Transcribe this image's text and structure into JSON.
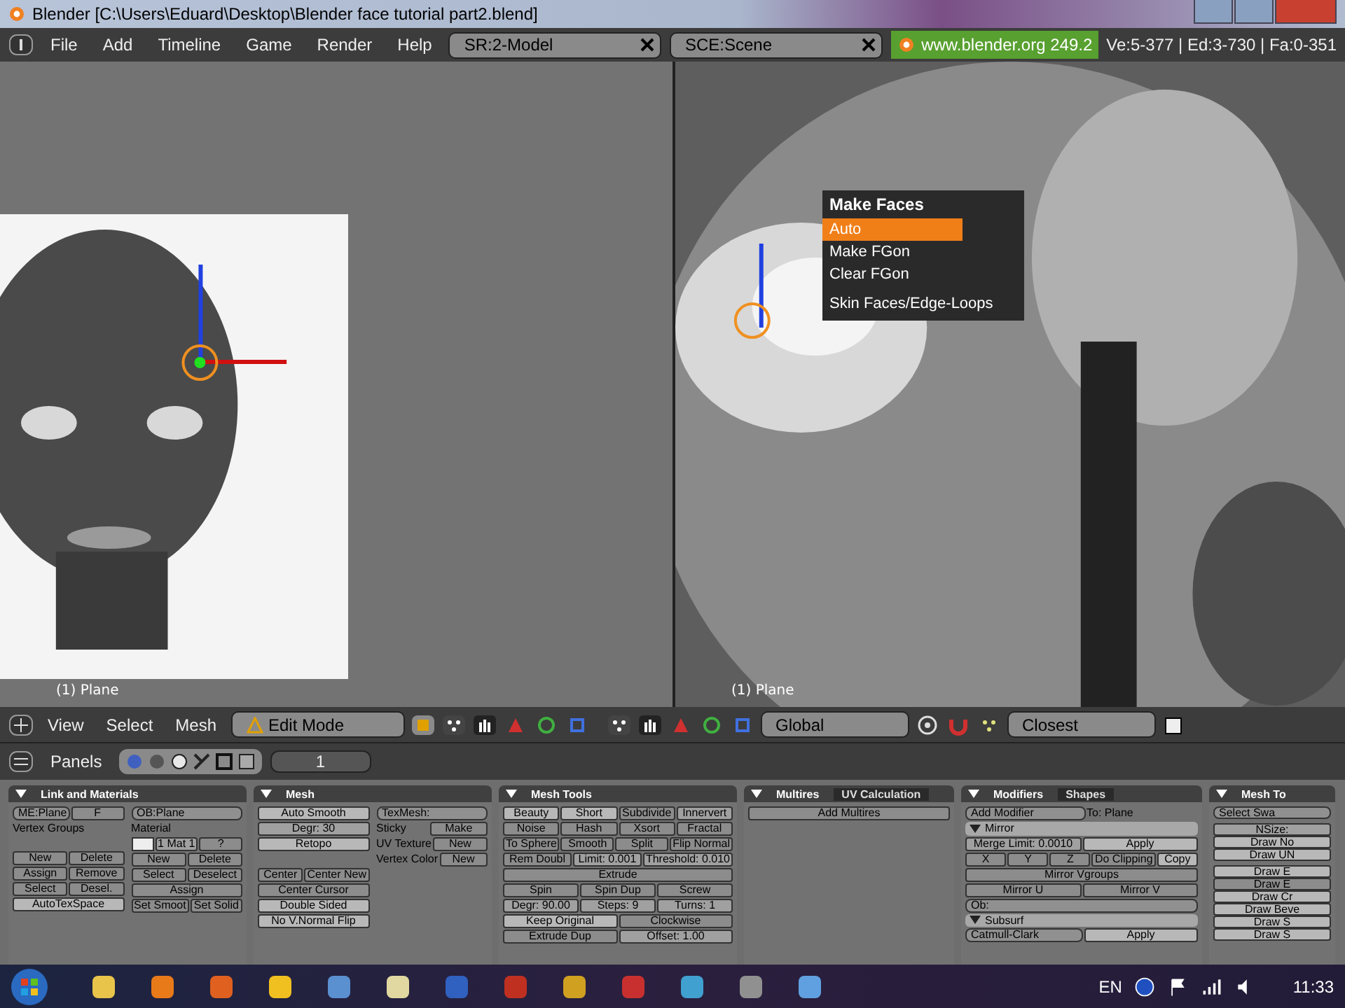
{
  "window": {
    "title": "Blender [C:\\Users\\Eduard\\Desktop\\Blender face tutorial part2.blend]"
  },
  "menu": [
    "File",
    "Add",
    "Timeline",
    "Game",
    "Render",
    "Help"
  ],
  "screen_field": "SR:2-Model",
  "scene_field": "SCE:Scene",
  "version": "www.blender.org 249.2",
  "stats": "Ve:5-377 | Ed:3-730 | Fa:0-351",
  "viewports": [
    {
      "label": "(1) Plane"
    },
    {
      "label": "(1) Plane"
    }
  ],
  "popup": {
    "title": "Make Faces",
    "items": [
      {
        "label": "Auto",
        "selected": true
      },
      {
        "label": "Make FGon",
        "selected": false
      },
      {
        "label": "Clear FGon",
        "selected": false
      },
      {
        "label": "Skin Faces/Edge-Loops",
        "selected": false
      }
    ]
  },
  "view_header": {
    "menu": [
      "View",
      "Select",
      "Mesh"
    ],
    "mode": "Edit Mode",
    "orientation": "Global",
    "snap": "Closest"
  },
  "buttons_header": {
    "label": "Panels",
    "frame": "1"
  },
  "panels": [
    {
      "tabs": [
        {
          "label": "Link and Materials",
          "selected": true
        }
      ],
      "columns": [
        [
          [
            {
              "kind": "field",
              "label": "ME:Plane"
            },
            {
              "kind": "button",
              "label": "F"
            }
          ],
          [
            {
              "kind": "label",
              "label": "Vertex Groups"
            }
          ],
          [
            {
              "kind": "space"
            }
          ],
          [
            {
              "kind": "button",
              "label": "New"
            },
            {
              "kind": "button",
              "label": "Delete"
            }
          ],
          [
            {
              "kind": "button",
              "label": "Assign"
            },
            {
              "kind": "button",
              "label": "Remove"
            }
          ],
          [
            {
              "kind": "button",
              "label": "Select"
            },
            {
              "kind": "button",
              "label": "Desel."
            }
          ],
          [
            {
              "kind": "light",
              "label": "AutoTexSpace"
            }
          ]
        ],
        [
          [
            {
              "kind": "field",
              "label": "OB:Plane"
            }
          ],
          [
            {
              "kind": "label",
              "label": "Material"
            }
          ],
          [
            {
              "kind": "swatch"
            },
            {
              "kind": "num",
              "label": "1 Mat 1"
            },
            {
              "kind": "button",
              "label": "?"
            }
          ],
          [
            {
              "kind": "button",
              "label": "New"
            },
            {
              "kind": "button",
              "label": "Delete"
            }
          ],
          [
            {
              "kind": "button",
              "label": "Select"
            },
            {
              "kind": "button",
              "label": "Deselect"
            }
          ],
          [
            {
              "kind": "button",
              "label": "Assign"
            }
          ],
          [
            {
              "kind": "button",
              "label": "Set Smoot"
            },
            {
              "kind": "button",
              "label": "Set Solid"
            }
          ]
        ]
      ]
    },
    {
      "tabs": [
        {
          "label": "Mesh",
          "selected": true
        }
      ],
      "columns": [
        [
          [
            {
              "kind": "light",
              "label": "Auto Smooth"
            }
          ],
          [
            {
              "kind": "num",
              "label": "Degr: 30"
            }
          ],
          [
            {
              "kind": "light",
              "label": "Retopo"
            }
          ],
          [
            {
              "kind": "space"
            }
          ],
          [
            {
              "kind": "button",
              "label": "Center"
            },
            {
              "kind": "button",
              "label": "Center New"
            }
          ],
          [
            {
              "kind": "button",
              "label": "Center Cursor"
            }
          ],
          [
            {
              "kind": "light",
              "label": "Double Sided"
            }
          ],
          [
            {
              "kind": "light",
              "label": "No V.Normal Flip"
            }
          ]
        ],
        [
          [
            {
              "kind": "field",
              "label": "TexMesh:"
            }
          ],
          [
            {
              "kind": "label",
              "label": "Sticky"
            },
            {
              "kind": "button",
              "label": "Make"
            }
          ],
          [
            {
              "kind": "label",
              "label": "UV Texture"
            },
            {
              "kind": "button",
              "label": "New"
            }
          ],
          [
            {
              "kind": "label",
              "label": "Vertex Color"
            },
            {
              "kind": "button",
              "label": "New"
            }
          ]
        ]
      ]
    },
    {
      "tabs": [
        {
          "label": "Mesh Tools",
          "selected": true
        }
      ],
      "columns": [
        [
          [
            {
              "kind": "light",
              "label": "Beauty"
            },
            {
              "kind": "light",
              "label": "Short"
            },
            {
              "kind": "button",
              "label": "Subdivide"
            },
            {
              "kind": "num",
              "label": "Innervert"
            }
          ],
          [
            {
              "kind": "button",
              "label": "Noise"
            },
            {
              "kind": "button",
              "label": "Hash"
            },
            {
              "kind": "button",
              "label": "Xsort"
            },
            {
              "kind": "button",
              "label": "Fractal"
            }
          ],
          [
            {
              "kind": "button",
              "label": "To Sphere"
            },
            {
              "kind": "button",
              "label": "Smooth"
            },
            {
              "kind": "button",
              "label": "Split"
            },
            {
              "kind": "button",
              "label": "Flip Normal"
            }
          ],
          [
            {
              "kind": "button",
              "label": "Rem Doubl"
            },
            {
              "kind": "num",
              "label": "Limit: 0.001"
            },
            {
              "kind": "num",
              "label": "Threshold: 0.010"
            }
          ],
          [
            {
              "kind": "button",
              "label": "Extrude"
            }
          ],
          [
            {
              "kind": "button",
              "label": "Spin"
            },
            {
              "kind": "button",
              "label": "Spin Dup"
            },
            {
              "kind": "button",
              "label": "Screw"
            }
          ],
          [
            {
              "kind": "num",
              "label": "Degr: 90.00"
            },
            {
              "kind": "num",
              "label": "Steps: 9"
            },
            {
              "kind": "num",
              "label": "Turns: 1"
            }
          ],
          [
            {
              "kind": "light",
              "label": "Keep Original"
            },
            {
              "kind": "button",
              "label": "Clockwise"
            }
          ],
          [
            {
              "kind": "button",
              "label": "Extrude Dup"
            },
            {
              "kind": "num",
              "label": "Offset: 1.00"
            }
          ]
        ]
      ]
    },
    {
      "tabs": [
        {
          "label": "Multires",
          "selected": true
        },
        {
          "label": "UV Calculation",
          "selected": false
        }
      ],
      "columns": [
        [
          [
            {
              "kind": "button",
              "label": "Add Multires"
            }
          ]
        ]
      ]
    },
    {
      "tabs": [
        {
          "label": "Modifiers",
          "selected": true
        },
        {
          "label": "Shapes",
          "selected": false
        }
      ],
      "columns": [
        [
          [
            {
              "kind": "field",
              "label": "Add Modifier"
            },
            {
              "kind": "label",
              "label": "To: Plane"
            }
          ],
          [
            {
              "kind": "modhead",
              "label": "Mirror"
            }
          ],
          [
            {
              "kind": "num",
              "label": "Merge Limit: 0.0010"
            },
            {
              "kind": "light",
              "label": "Apply"
            }
          ],
          [
            {
              "kind": "button",
              "label": "X"
            },
            {
              "kind": "button",
              "label": "Y"
            },
            {
              "kind": "button",
              "label": "Z"
            },
            {
              "kind": "button",
              "label": "Do Clipping"
            },
            {
              "kind": "light",
              "label": "Copy"
            }
          ],
          [
            {
              "kind": "button",
              "label": "Mirror Vgroups"
            }
          ],
          [
            {
              "kind": "button",
              "label": "Mirror U"
            },
            {
              "kind": "button",
              "label": "Mirror V"
            }
          ],
          [
            {
              "kind": "field",
              "label": "Ob:"
            }
          ],
          [
            {
              "kind": "modhead",
              "label": "Subsurf"
            }
          ],
          [
            {
              "kind": "field",
              "label": "Catmull-Clark"
            },
            {
              "kind": "light",
              "label": "Apply"
            }
          ]
        ]
      ]
    },
    {
      "tabs": [
        {
          "label": "Mesh To",
          "selected": true
        }
      ],
      "columns": [
        [
          [
            {
              "kind": "field",
              "label": "Select Swa"
            }
          ],
          [
            {
              "kind": "space"
            }
          ],
          [
            {
              "kind": "num",
              "label": "NSize:"
            }
          ],
          [
            {
              "kind": "light",
              "label": "Draw No"
            }
          ],
          [
            {
              "kind": "light",
              "label": "Draw UN"
            }
          ],
          [
            {
              "kind": "space"
            }
          ],
          [
            {
              "kind": "light",
              "label": "Draw E"
            }
          ],
          [
            {
              "kind": "button",
              "label": "Draw E"
            }
          ],
          [
            {
              "kind": "light",
              "label": "Draw Cr"
            }
          ],
          [
            {
              "kind": "light",
              "label": "Draw Beve"
            }
          ],
          [
            {
              "kind": "light",
              "label": "Draw S"
            }
          ],
          [
            {
              "kind": "light",
              "label": "Draw S"
            }
          ]
        ]
      ]
    }
  ],
  "taskbar": {
    "language": "EN",
    "time": "11:33"
  }
}
